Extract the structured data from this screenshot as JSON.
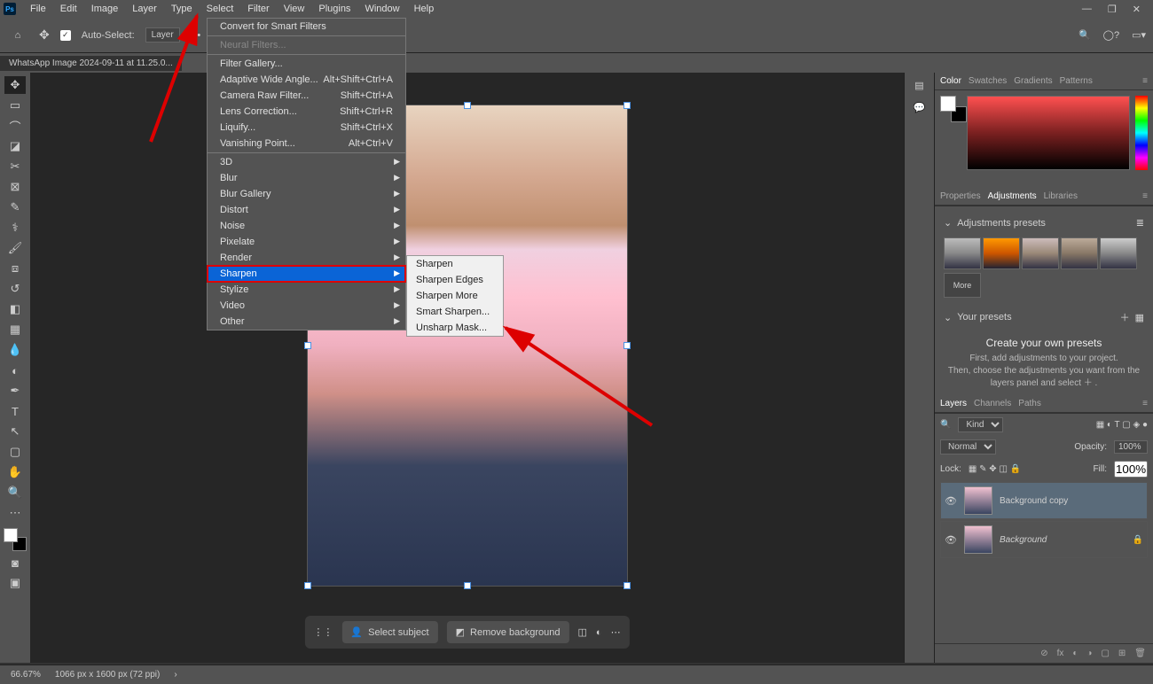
{
  "menubar": [
    "File",
    "Edit",
    "Image",
    "Layer",
    "Type",
    "Select",
    "Filter",
    "View",
    "Plugins",
    "Window",
    "Help"
  ],
  "optbar": {
    "auto_select": "Auto-Select:",
    "layer": "Layer"
  },
  "doc_tab": "WhatsApp Image 2024-09-11 at 11.25.0...",
  "filter_menu": {
    "convert": "Convert for Smart Filters",
    "neural": "Neural Filters...",
    "gallery": "Filter Gallery...",
    "adaptive": {
      "label": "Adaptive Wide Angle...",
      "shortcut": "Alt+Shift+Ctrl+A"
    },
    "camera": {
      "label": "Camera Raw Filter...",
      "shortcut": "Shift+Ctrl+A"
    },
    "lens": {
      "label": "Lens Correction...",
      "shortcut": "Shift+Ctrl+R"
    },
    "liquify": {
      "label": "Liquify...",
      "shortcut": "Shift+Ctrl+X"
    },
    "vanish": {
      "label": "Vanishing Point...",
      "shortcut": "Alt+Ctrl+V"
    },
    "cats": [
      "3D",
      "Blur",
      "Blur Gallery",
      "Distort",
      "Noise",
      "Pixelate",
      "Render",
      "Sharpen",
      "Stylize",
      "Video",
      "Other"
    ]
  },
  "sharpen_submenu": [
    "Sharpen",
    "Sharpen Edges",
    "Sharpen More",
    "Smart Sharpen...",
    "Unsharp Mask..."
  ],
  "ctx": {
    "select_subject": "Select subject",
    "remove_bg": "Remove background"
  },
  "right": {
    "color_tabs": [
      "Color",
      "Swatches",
      "Gradients",
      "Patterns"
    ],
    "prop_tabs": [
      "Properties",
      "Adjustments",
      "Libraries"
    ],
    "adj_presets": "Adjustments presets",
    "more": "More",
    "your_presets": "Your presets",
    "create_title": "Create your own presets",
    "create_sub1": "First, add adjustments to your project.",
    "create_sub2": "Then, choose the adjustments you want from the layers panel and select  ＋ .",
    "layer_tabs": [
      "Layers",
      "Channels",
      "Paths"
    ],
    "kind": "Kind",
    "normal": "Normal",
    "opacity_lbl": "Opacity:",
    "opacity_val": "100%",
    "lock_lbl": "Lock:",
    "fill_lbl": "Fill:",
    "fill_val": "100%",
    "layer1": "Background copy",
    "layer2": "Background"
  },
  "status": {
    "zoom": "66.67%",
    "dims": "1066 px x 1600 px (72 ppi)"
  }
}
